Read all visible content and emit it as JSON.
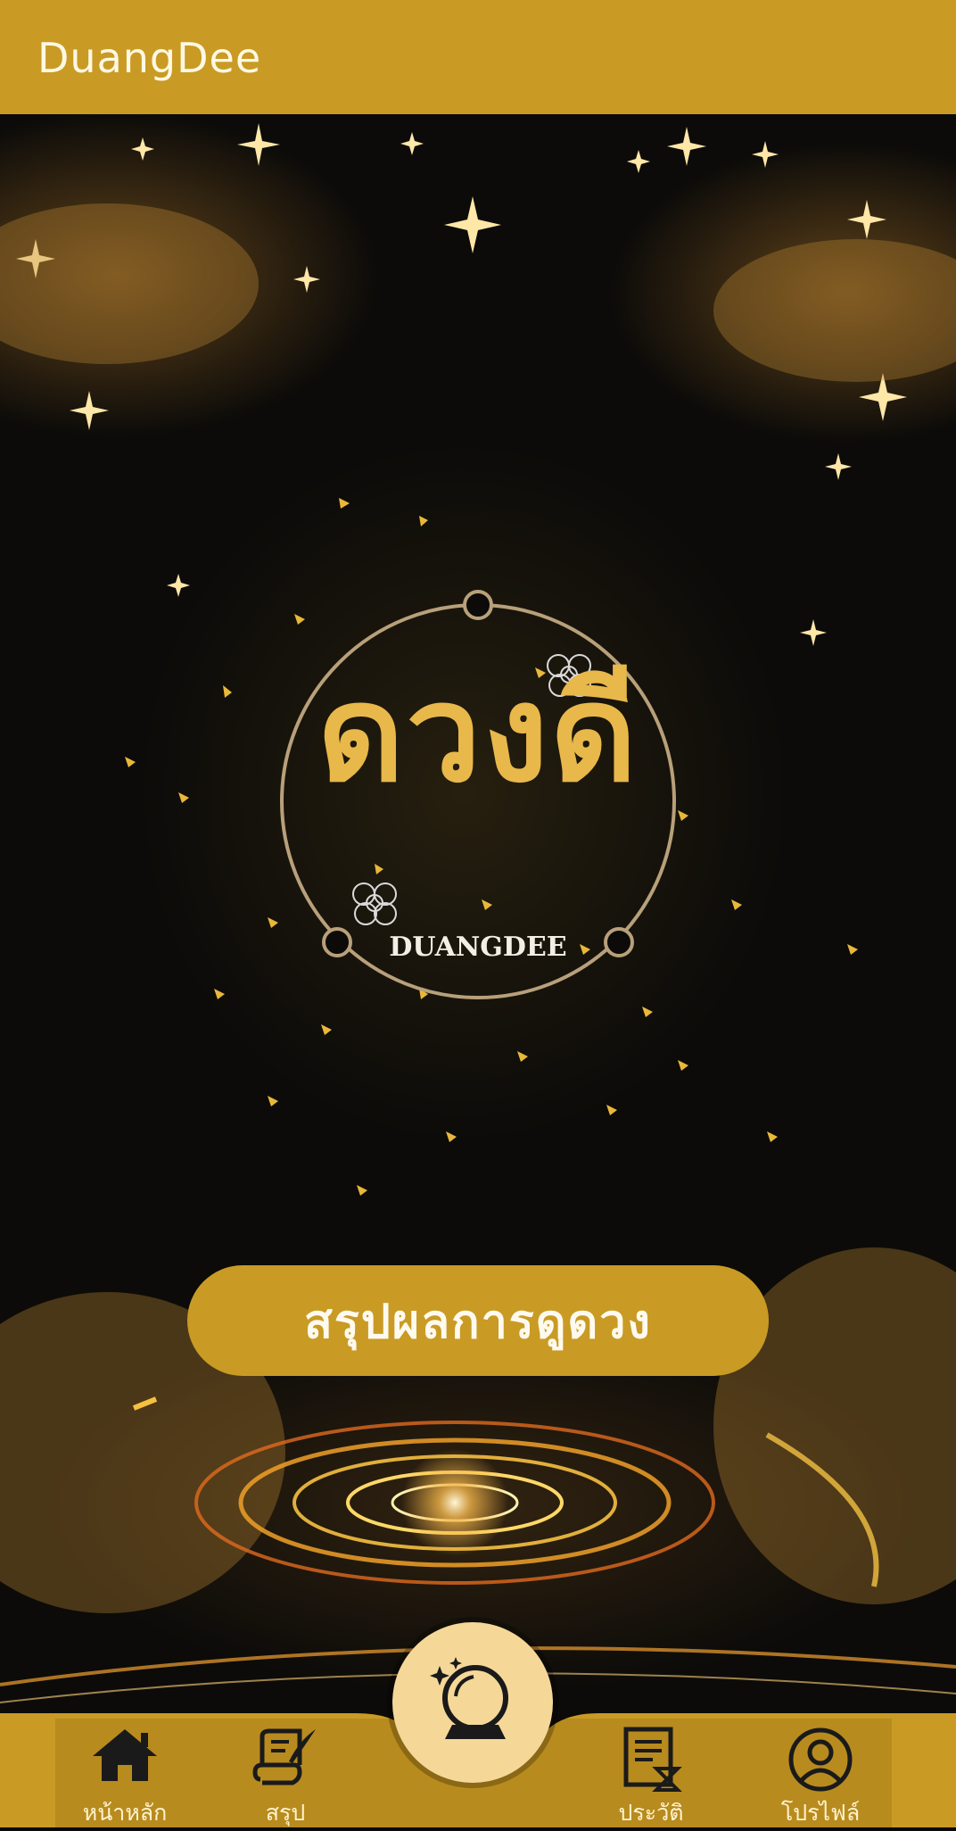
{
  "appbar": {
    "title": "DuangDee"
  },
  "logo": {
    "thai_text": "ดวงดี",
    "latin_text": "DUANGDEE"
  },
  "main": {
    "summary_button_label": "สรุปผลการดูดวง"
  },
  "bottom_nav": {
    "items": [
      {
        "label": "หน้าหลัก",
        "icon": "home-icon"
      },
      {
        "label": "สรุป",
        "icon": "scroll-quill-icon"
      },
      {
        "label": "ประวัติ",
        "icon": "history-document-icon"
      },
      {
        "label": "โปรไฟล์",
        "icon": "profile-icon"
      }
    ],
    "center_button_icon": "crystal-ball-icon"
  },
  "colors": {
    "gold": "#c99b24",
    "gold_light": "#f5d898",
    "logo_gold": "#e8b84a",
    "background": "#0c0b09"
  }
}
